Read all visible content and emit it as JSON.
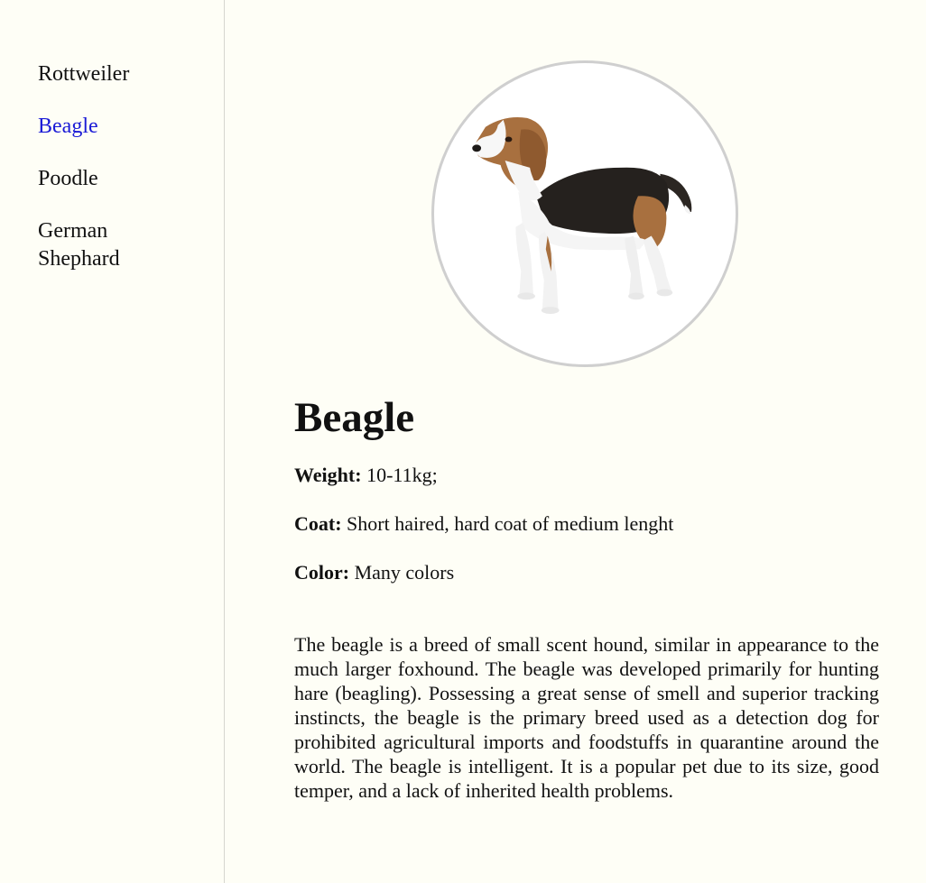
{
  "sidebar": {
    "items": [
      {
        "label": "Rottweiler"
      },
      {
        "label": "Beagle"
      },
      {
        "label": "Poodle"
      },
      {
        "label": "German Shephard"
      }
    ],
    "active_index": 1,
    "active_color": "#1a1ad6"
  },
  "breed": {
    "photo_icon": "beagle-photo",
    "name": "Beagle",
    "weight_label": "Weight:",
    "weight_value": "10-11kg;",
    "coat_label": "Coat:",
    "coat_value": "Short haired, hard coat of medium lenght",
    "color_label": "Color:",
    "color_value": "Many colors",
    "description": "The beagle is a breed of small scent hound, similar in appearance to the much larger foxhound. The beagle was developed primarily for hunting hare (beagling). Possessing a great sense of smell and superior tracking instincts, the beagle is the primary breed used as a detection dog for prohibited agricultural imports and foodstuffs in quarantine around the world. The beagle is intelligent. It is a popular pet due to its size, good temper, and a lack of inherited health problems."
  }
}
